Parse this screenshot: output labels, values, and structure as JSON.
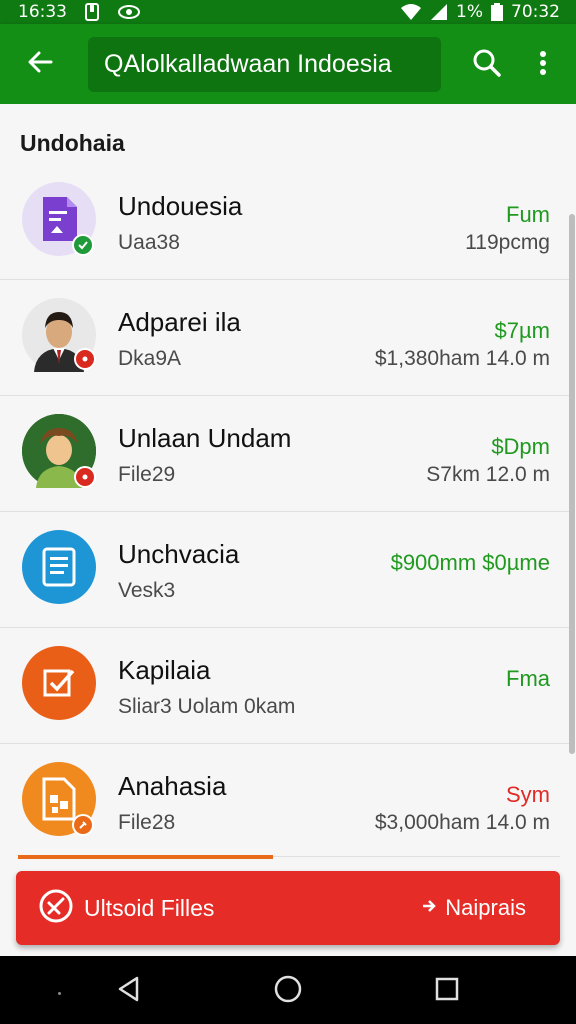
{
  "status_bar": {
    "time_left": "16:33",
    "battery_percent": "1%",
    "time_right": "70:32",
    "icons": [
      "sim-icon",
      "eye-icon",
      "wifi-icon",
      "signal-icon",
      "battery-icon"
    ]
  },
  "app_bar": {
    "search_text": "QAlolkalladwaan Indoesia",
    "icons": [
      "back-arrow-icon",
      "search-icon",
      "more-vertical-icon"
    ]
  },
  "section": {
    "title": "Undohaia"
  },
  "list": [
    {
      "title": "Undouesia",
      "subtitle": "Uaa38",
      "amount": "Fum",
      "amount_color": "#1f9a1f",
      "meta": "119pcmg",
      "avatar_icon": "document-icon",
      "avatar_bg": "#e6def5",
      "badge_icon": "check-icon",
      "badge_color": "#1f9a3a"
    },
    {
      "title": "Adparei ila",
      "subtitle": "Dka9A",
      "amount": "$7µm",
      "amount_color": "#1f9a1f",
      "meta": "$1,380ham  14.0 m",
      "avatar_icon": "man-portrait-icon",
      "avatar_bg": "#e8e8e8",
      "badge_icon": "alert-dot-icon",
      "badge_color": "#d92a1f"
    },
    {
      "title": "Unlaan Undam",
      "subtitle": "File29",
      "amount": "$Dpm",
      "amount_color": "#1f9a1f",
      "meta": "S7km  12.0 m",
      "avatar_icon": "woman-portrait-icon",
      "avatar_bg": "#2f6d2c",
      "badge_icon": "alert-dot-icon",
      "badge_color": "#d92a1f"
    },
    {
      "title": "Unchvacia",
      "subtitle": "Vesk3",
      "amount": "$900mm  $0µme",
      "amount_color": "#1f9a1f",
      "meta": "",
      "avatar_icon": "text-document-icon",
      "avatar_bg": "#1e96d6",
      "badge_icon": "",
      "badge_color": ""
    },
    {
      "title": "Kapilaia",
      "subtitle": "Sliar3  Uolam 0kam",
      "amount": "Fma",
      "amount_color": "#1f9a1f",
      "meta": "",
      "avatar_icon": "checkbox-icon",
      "avatar_bg": "#ea5f17",
      "badge_icon": "",
      "badge_color": ""
    },
    {
      "title": "Anahasia",
      "subtitle": "File28",
      "amount": "Sym",
      "amount_color": "#e02a26",
      "meta": "$3,000ham  14.0 m",
      "avatar_icon": "image-file-icon",
      "avatar_bg": "#f08a1f",
      "badge_icon": "pin-icon",
      "badge_color": "#ea6a17"
    }
  ],
  "upload_progress": 0.47,
  "action_bar": {
    "upload_label": "Ultsoid Filles",
    "next_label": "Naiprais",
    "icons": [
      "cancel-circle-icon",
      "chevron-right-icon"
    ]
  },
  "nav_bar": {
    "icons": [
      "back-triangle-icon",
      "home-circle-icon",
      "recents-square-icon"
    ]
  }
}
